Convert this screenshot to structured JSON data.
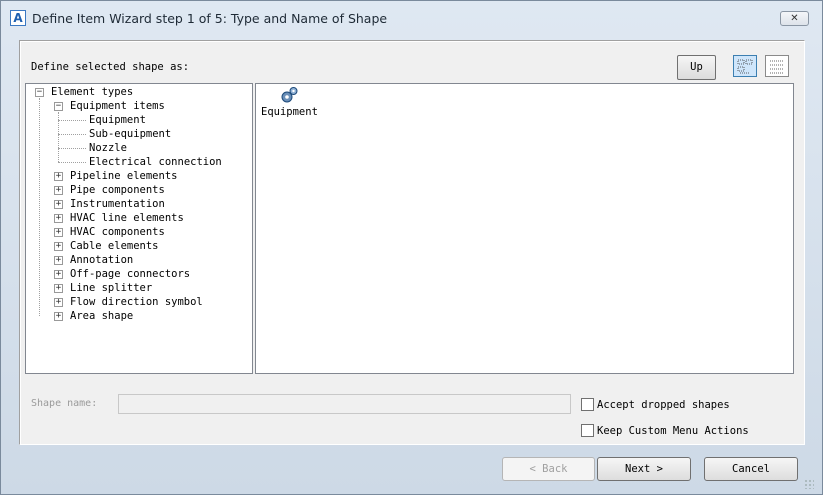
{
  "window": {
    "title": "Define Item Wizard step 1 of 5: Type and Name of Shape",
    "close_glyph": "✕",
    "app_icon": "A"
  },
  "toolbar": {
    "define_label": "Define selected shape as:",
    "up_label": "Up"
  },
  "tree": {
    "root": "Element types",
    "group": "Equipment items",
    "children": [
      "Equipment",
      "Sub-equipment",
      "Nozzle",
      "Electrical connection"
    ],
    "items": [
      "Pipeline elements",
      "Pipe components",
      "Instrumentation",
      "HVAC line elements",
      "HVAC components",
      "Cable elements",
      "Annotation",
      "Off-page connectors",
      "Line splitter",
      "Flow direction symbol",
      "Area shape"
    ]
  },
  "shapes": [
    {
      "label": "Equipment",
      "icon": "gears-icon"
    }
  ],
  "form": {
    "shape_name_label": "Shape name:",
    "shape_name_value": "",
    "accept_dropped_label": "Accept dropped shapes",
    "accept_dropped_checked": false,
    "keep_menu_label": "Keep Custom Menu Actions",
    "keep_menu_checked": false
  },
  "buttons": {
    "back_label": "<  Back",
    "next_label": "Next  >",
    "cancel_label": "Cancel"
  }
}
